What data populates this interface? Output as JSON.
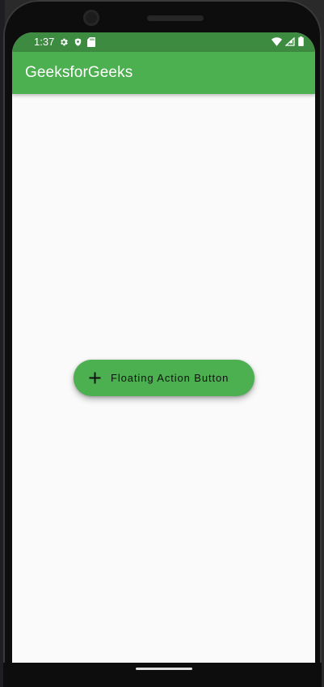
{
  "status_bar": {
    "time": "1:37",
    "icons_left": [
      "gear-icon",
      "shield-icon",
      "sd-card-icon"
    ],
    "icons_right": [
      "wifi-icon",
      "cellular-signal-icon",
      "battery-icon"
    ],
    "background_color": "#3d8b40"
  },
  "app_bar": {
    "title": "GeeksforGeeks",
    "background_color": "#4caf50"
  },
  "fab": {
    "icon": "plus-icon",
    "label": "Floating Action Button",
    "background_color": "#4caf50"
  },
  "screen": {
    "background_color": "#fafafa"
  }
}
